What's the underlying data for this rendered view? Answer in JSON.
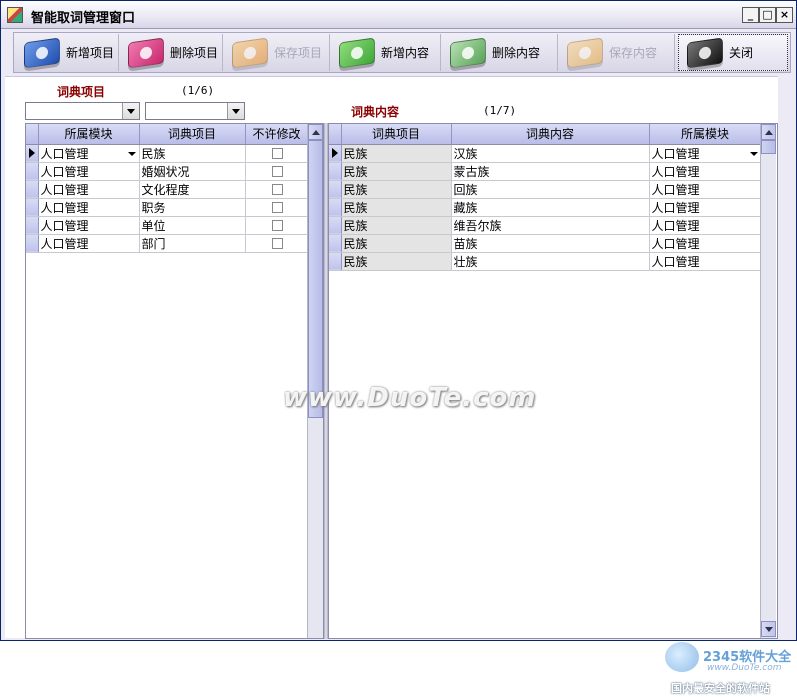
{
  "window": {
    "title": "智能取词管理窗口"
  },
  "toolbar": [
    {
      "label": "新增项目",
      "icon": "blue-gem-icon",
      "color": "#1f4fb0",
      "enabled": true
    },
    {
      "label": "删除项目",
      "icon": "pink-gem-icon",
      "color": "#c8286e",
      "enabled": true
    },
    {
      "label": "保存项目",
      "icon": "orange-gem-icon",
      "color": "#e88a1e",
      "enabled": false
    },
    {
      "label": "新增内容",
      "icon": "green-gem-icon",
      "color": "#3fa83a",
      "enabled": true
    },
    {
      "label": "删除内容",
      "icon": "green-gem-icon",
      "color": "#5aa35a",
      "enabled": true
    },
    {
      "label": "保存内容",
      "icon": "orange-gem-icon",
      "color": "#e8a43a",
      "enabled": false
    },
    {
      "label": "关闭",
      "icon": "black-gem-icon",
      "color": "#222222",
      "enabled": true
    }
  ],
  "left": {
    "title": "词典项目",
    "counter": "(1/6)",
    "columns": [
      "所属模块",
      "词典项目",
      "不许修改"
    ],
    "rows": [
      [
        "人口管理",
        "民族",
        ""
      ],
      [
        "人口管理",
        "婚姻状况",
        ""
      ],
      [
        "人口管理",
        "文化程度",
        ""
      ],
      [
        "人口管理",
        "职务",
        ""
      ],
      [
        "人口管理",
        "单位",
        ""
      ],
      [
        "人口管理",
        "部门",
        ""
      ]
    ]
  },
  "right": {
    "title": "词典内容",
    "counter": "(1/7)",
    "columns": [
      "词典项目",
      "词典内容",
      "所属模块"
    ],
    "rows": [
      [
        "民族",
        "汉族",
        "人口管理"
      ],
      [
        "民族",
        "蒙古族",
        "人口管理"
      ],
      [
        "民族",
        "回族",
        "人口管理"
      ],
      [
        "民族",
        "藏族",
        "人口管理"
      ],
      [
        "民族",
        "维吾尔族",
        "人口管理"
      ],
      [
        "民族",
        "苗族",
        "人口管理"
      ],
      [
        "民族",
        "壮族",
        "人口管理"
      ]
    ]
  },
  "watermark": {
    "site": "www.DuoTe.com",
    "brand_name": "2345软件大全",
    "brand_url": "www.DuoTe.com",
    "brand_slogan": "国内最安全的软件站"
  }
}
